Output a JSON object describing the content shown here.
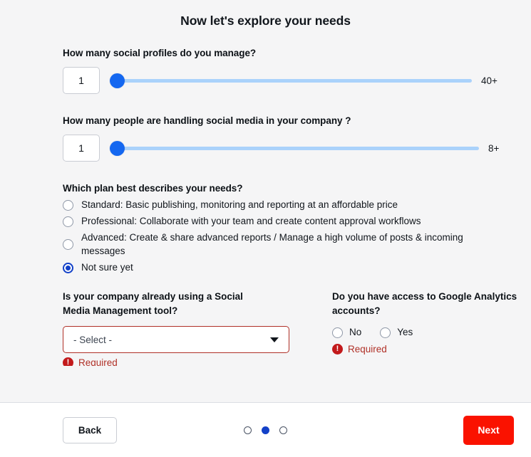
{
  "page": {
    "title": "Now let's explore your needs"
  },
  "questions": {
    "profiles": {
      "label": "How many social profiles do you manage?",
      "value": "1",
      "max_label": "40+",
      "track_width": 508,
      "thumb_percent": 0
    },
    "people": {
      "label": "How many people are handling social media in your company ?",
      "value": "1",
      "max_label": "8+",
      "track_width": 518,
      "thumb_percent": 0
    },
    "plan": {
      "label": "Which plan best describes your needs?",
      "options": [
        {
          "label": "Standard: Basic publishing, monitoring and reporting at an affordable price",
          "selected": false
        },
        {
          "label": "Professional: Collaborate with your team and create content approval workflows",
          "selected": false
        },
        {
          "label": "Advanced: Create & share advanced reports / Manage a high volume of posts & incoming messages",
          "selected": false
        },
        {
          "label": "Not sure yet",
          "selected": true
        }
      ]
    },
    "tool": {
      "label": "Is your company already using a Social Media Management tool?",
      "selected_value": "- Select -",
      "placeholder": "- Select -",
      "error": "Required",
      "caret": "chevron-down-icon"
    },
    "analytics": {
      "label": "Do you have access to Google Analytics accounts?",
      "options": [
        {
          "label": "No",
          "selected": false
        },
        {
          "label": "Yes",
          "selected": false
        }
      ],
      "error": "Required",
      "error_icon": "!"
    }
  },
  "footer": {
    "back_label": "Back",
    "next_label": "Next",
    "dots": [
      {
        "active": false
      },
      {
        "active": true
      },
      {
        "active": false
      }
    ]
  },
  "colors": {
    "accent_blue": "#1467f0",
    "radio_blue": "#1341c8",
    "track_blue": "#aad2fb",
    "error_red": "#b03027",
    "next_red": "#fa1200",
    "page_bg": "#f5f5f6"
  }
}
